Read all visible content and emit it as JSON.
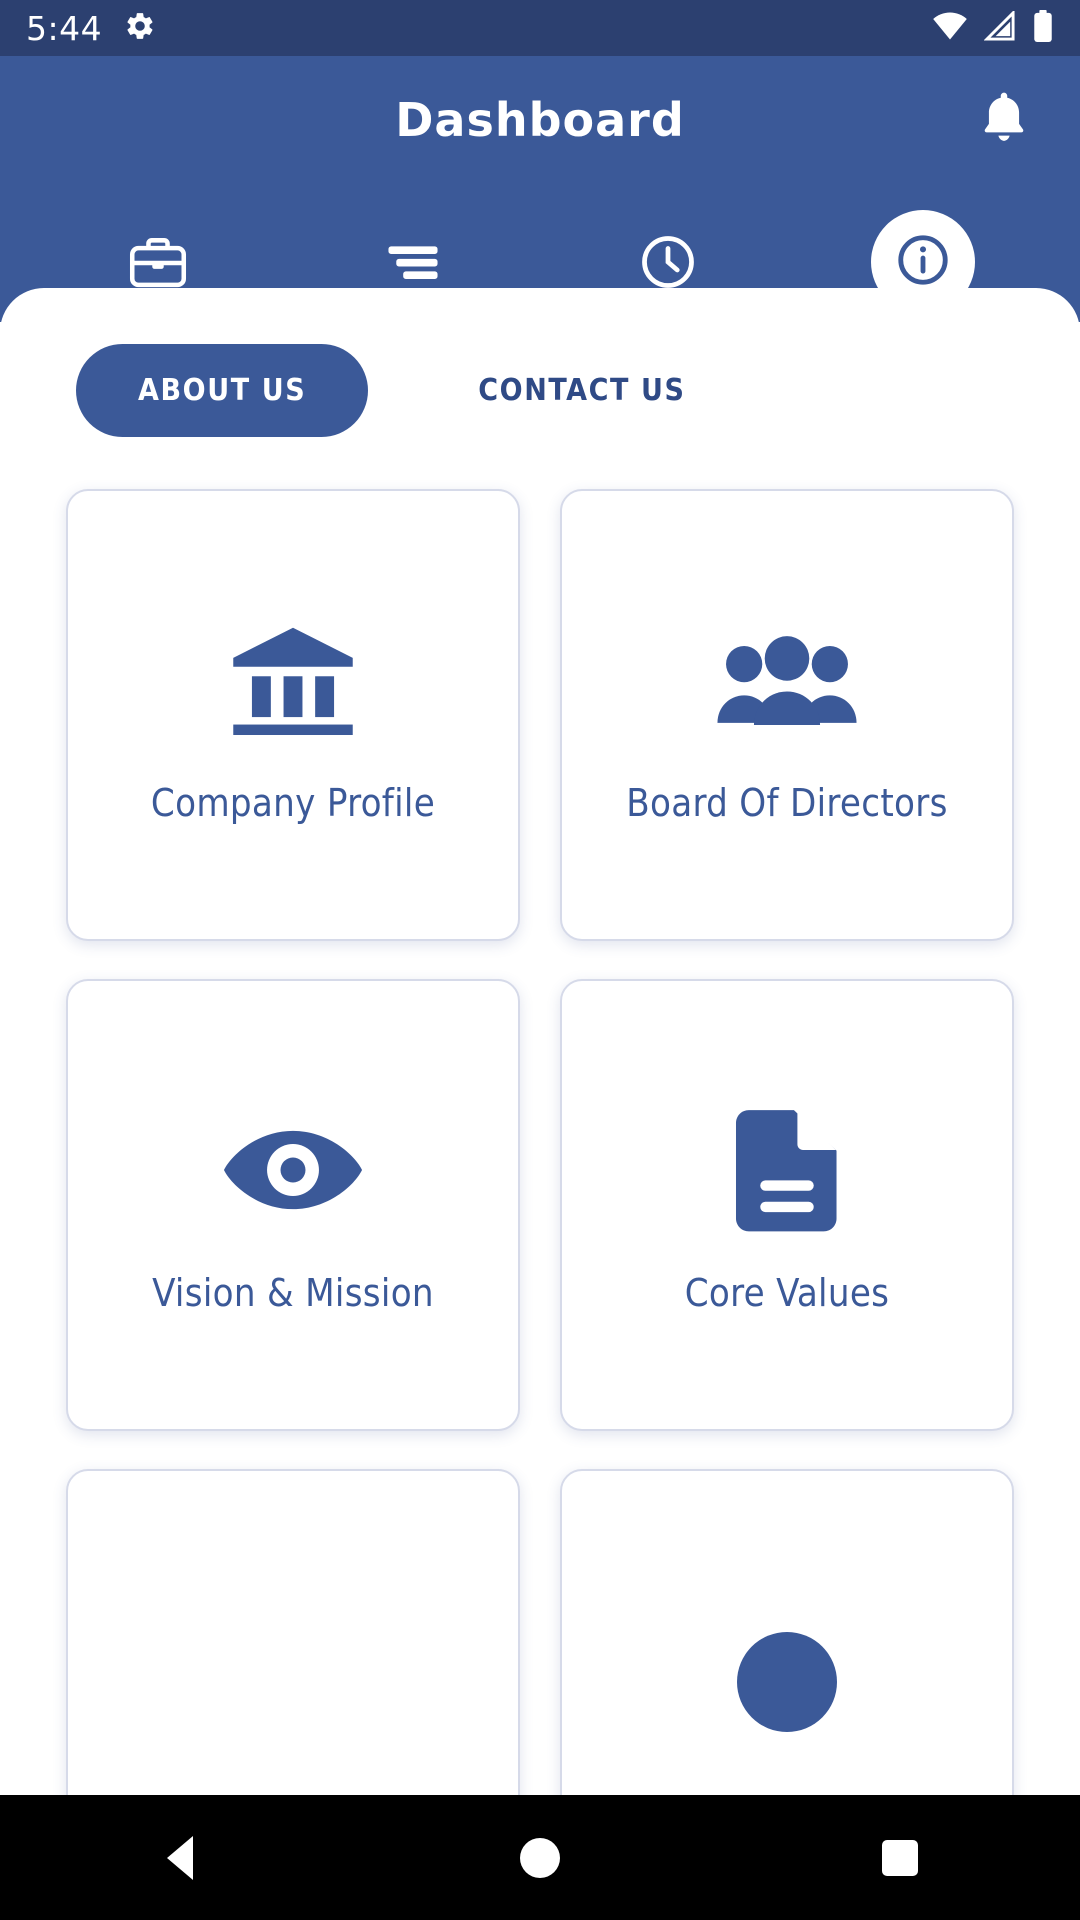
{
  "status_bar": {
    "time": "5:44",
    "icons": [
      "gear-icon",
      "wifi-icon",
      "cellular-signal-icon",
      "battery-icon"
    ],
    "background_color": "#2c4070"
  },
  "header": {
    "title": "Dashboard",
    "background_color": "#3b5998",
    "notification_icon": "bell-icon",
    "icon_tabs": [
      {
        "icon": "briefcase-icon",
        "name": "briefcase",
        "active": false
      },
      {
        "icon": "sort-lines-icon",
        "name": "menu-lines",
        "active": false
      },
      {
        "icon": "clock-icon",
        "name": "clock",
        "active": false
      },
      {
        "icon": "info-circle-icon",
        "name": "info",
        "active": true
      }
    ]
  },
  "tabs": [
    {
      "label": "ABOUT US",
      "active": true
    },
    {
      "label": "CONTACT US",
      "active": false
    }
  ],
  "cards": [
    {
      "label": "Company Profile",
      "icon": "bank-building-icon"
    },
    {
      "label": "Board Of Directors",
      "icon": "people-group-icon"
    },
    {
      "label": "Vision & Mission",
      "icon": "eye-icon"
    },
    {
      "label": "Core Values",
      "icon": "document-icon"
    },
    {
      "label": "",
      "icon": ""
    },
    {
      "label": "",
      "icon": "circle-partial-icon"
    }
  ],
  "nav_bar": {
    "back_label": "Back",
    "home_label": "Home",
    "recents_label": "Recents",
    "background_color": "#000000"
  },
  "colors": {
    "primary": "#3b5998",
    "status_bar": "#2c4070",
    "card_border": "#d6dae9",
    "text_blue": "#3b5998"
  }
}
